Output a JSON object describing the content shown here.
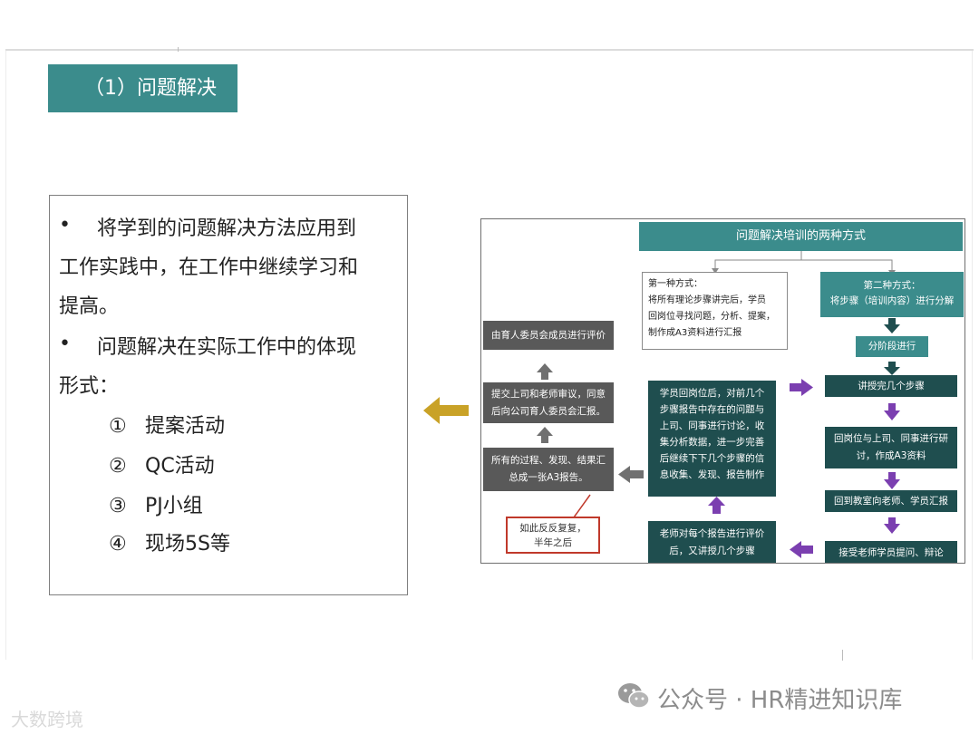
{
  "slide": {
    "title": "（1）问题解决",
    "bullets": [
      {
        "marker": "•",
        "lines": [
          "将学到的问题解决方法应用到",
          "工作实践中，在工作中继续学习和",
          "提高。"
        ]
      },
      {
        "marker": "•",
        "lines": [
          "问题解决在实际工作中的体现",
          "形式："
        ]
      }
    ],
    "items": [
      {
        "num": "①",
        "text": "提案活动"
      },
      {
        "num": "②",
        "text": "QC活动"
      },
      {
        "num": "③",
        "text": "PJ小组"
      },
      {
        "num": "④",
        "text": "现场5S等"
      }
    ]
  },
  "diagram": {
    "title": "问题解决培训的两种方式",
    "method1": [
      "第一种方式：",
      "将所有理论步骤讲完后，学员",
      "回岗位寻找问题，分析、提案，",
      "制作成A3资料进行汇报"
    ],
    "method2": [
      "第二种方式：",
      "将步骤（培训内容）进行分解"
    ],
    "right_steps": [
      "分阶段进行",
      "讲授完几个步骤",
      "回岗位与上司、同事进行研讨，作成A3资料",
      "回到教室向老师、学员汇报",
      "接受老师学员提问、辩论"
    ],
    "middle_top": "学员回岗位后，对前几个步骤报告中存在的问题与上司、同事进行讨论，收集分析数据，进一步完善后继续下下几个步骤的信息收集、发现、报告制作",
    "middle_bottom": "老师对每个报告进行评价后，又讲授几个步骤",
    "left_steps": [
      "由育人委员会成员进行评价",
      "提交上司和老师审议，同意后向公司育人委员会汇报。",
      "所有的过程、发现、结果汇总成一张A3报告。"
    ],
    "repeat_note": [
      "如此反反复复，",
      "半年之后"
    ],
    "colors": {
      "teal": "#3b8c8c",
      "dark": "#1f4e4f",
      "gray": "#595959",
      "purple": "#7b3fb0",
      "red": "#c0392b",
      "gold": "#c9a227"
    }
  },
  "watermark": {
    "account": "公众号 · HR精进知识库",
    "brand": "大数跨境"
  }
}
